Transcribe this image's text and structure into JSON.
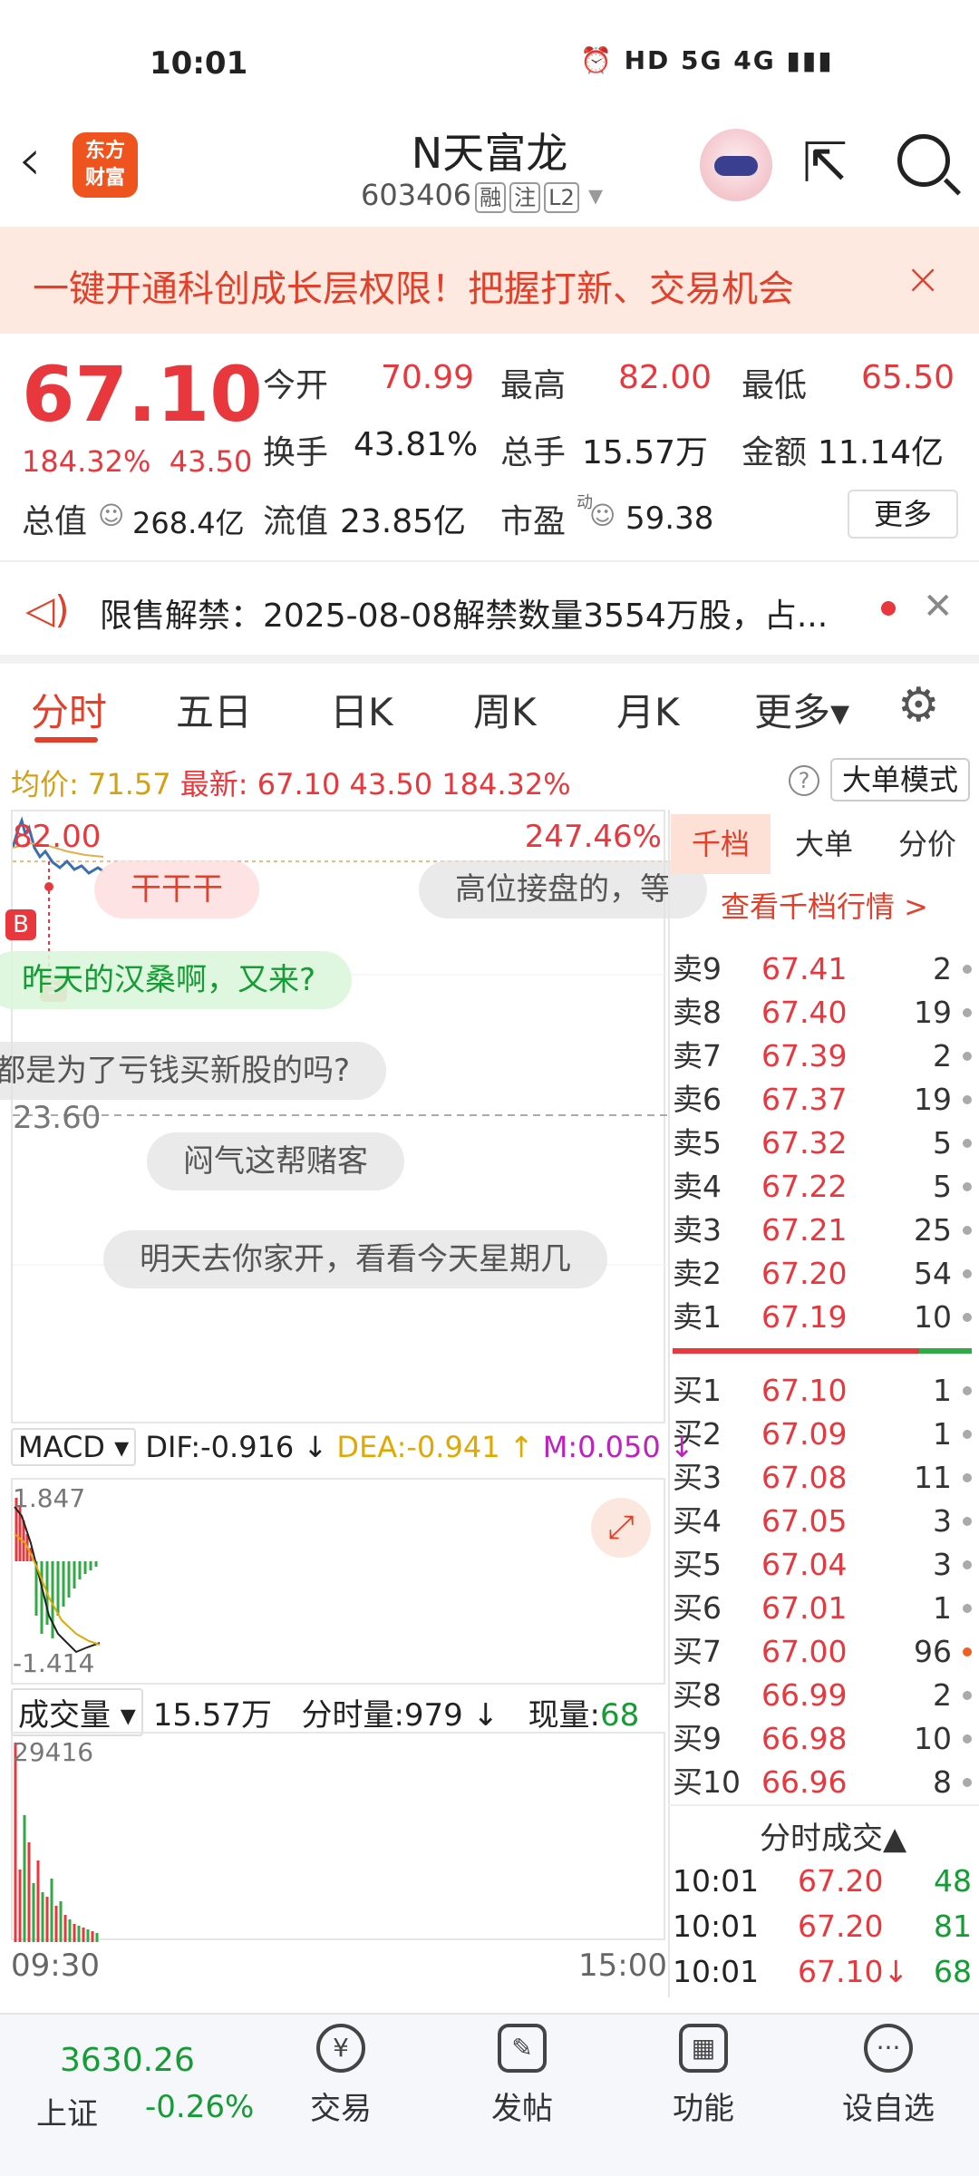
{
  "status": {
    "time": "10:01",
    "icons": "⏰ HD 5G 4G ▮▮▮"
  },
  "header": {
    "logo": "东方\n财富",
    "name": "N天富龙",
    "code": "603406",
    "badges": [
      "融",
      "注",
      "L2"
    ]
  },
  "promo": {
    "text": "一键开通科创成长层权限！把握打新、交易机会",
    "close": "×"
  },
  "quote": {
    "price": "67.10",
    "change_pct": "184.32%",
    "change": "43.50",
    "open_label": "今开",
    "open": "70.99",
    "high_label": "最高",
    "high": "82.00",
    "low_label": "最低",
    "low": "65.50",
    "turnover_label": "换手",
    "turnover": "43.81%",
    "volume_label": "总手",
    "volume": "15.57万",
    "amount_label": "金额",
    "amount": "11.14亿",
    "mcap_label": "总值",
    "mcap": "268.4亿",
    "float_label": "流值",
    "float": "23.85亿",
    "pe_label": "市盈",
    "pe_sup": "动",
    "pe": "59.38",
    "more": "更多"
  },
  "notice": {
    "text": "限售解禁：2025-08-08解禁数量3554万股，占..."
  },
  "tabs": [
    "分时",
    "五日",
    "日K",
    "周K",
    "月K",
    "更多▾"
  ],
  "info": {
    "avg_label": "均价:",
    "avg": "71.57",
    "latest_label": "最新:",
    "latest": "67.10",
    "chg": "43.50",
    "pct": "184.32%",
    "help": "?",
    "bigmode": "大单模式"
  },
  "chart": {
    "top_price": "82.00",
    "top_pct": "247.46%",
    "mid_price": "23.60",
    "danmu": [
      "干干干",
      "高位接盘的，等",
      "昨天的汉桑啊，又来?",
      "都是为了亏钱买新股的吗?",
      "闷气这帮赌客",
      "明天去你家开，看看今天星期几"
    ],
    "marker_b": "B",
    "marker_s": "S"
  },
  "orderbook": {
    "tabs": [
      "千档",
      "大单",
      "分价"
    ],
    "link": "查看千档行情 >",
    "asks": [
      {
        "label": "卖9",
        "price": "67.41",
        "vol": "2"
      },
      {
        "label": "卖8",
        "price": "67.40",
        "vol": "19"
      },
      {
        "label": "卖7",
        "price": "67.39",
        "vol": "2"
      },
      {
        "label": "卖6",
        "price": "67.37",
        "vol": "19"
      },
      {
        "label": "卖5",
        "price": "67.32",
        "vol": "5"
      },
      {
        "label": "卖4",
        "price": "67.22",
        "vol": "5"
      },
      {
        "label": "卖3",
        "price": "67.21",
        "vol": "25"
      },
      {
        "label": "卖2",
        "price": "67.20",
        "vol": "54"
      },
      {
        "label": "卖1",
        "price": "67.19",
        "vol": "10"
      }
    ],
    "bids": [
      {
        "label": "买1",
        "price": "67.10",
        "vol": "1"
      },
      {
        "label": "买2",
        "price": "67.09",
        "vol": "1"
      },
      {
        "label": "买3",
        "price": "67.08",
        "vol": "11"
      },
      {
        "label": "买4",
        "price": "67.05",
        "vol": "3"
      },
      {
        "label": "买5",
        "price": "67.04",
        "vol": "3"
      },
      {
        "label": "买6",
        "price": "67.01",
        "vol": "1"
      },
      {
        "label": "买7",
        "price": "67.00",
        "vol": "96"
      },
      {
        "label": "买8",
        "price": "66.99",
        "vol": "2"
      },
      {
        "label": "买9",
        "price": "66.98",
        "vol": "10"
      },
      {
        "label": "买10",
        "price": "66.96",
        "vol": "8"
      }
    ],
    "trades_title": "分时成交▲",
    "trades": [
      {
        "time": "10:01",
        "price": "67.20",
        "vol": "48"
      },
      {
        "time": "10:01",
        "price": "67.20",
        "vol": "81"
      },
      {
        "time": "10:01",
        "price": "67.10↓",
        "vol": "68"
      }
    ]
  },
  "macd": {
    "label": "MACD ▾",
    "dif": "DIF:-0.916 ↓",
    "dea": "DEA:-0.941 ↑",
    "m": "M:0.050 ↓",
    "top": "1.847",
    "bottom": "-1.414"
  },
  "volume": {
    "label": "成交量 ▾",
    "total": "15.57万",
    "per": "分时量:979 ↓",
    "now_label": "现量:",
    "now": "68",
    "top": "29416"
  },
  "time_axis": {
    "start": "09:30",
    "end": "15:00"
  },
  "bottom_nav": {
    "index_value": "3630.26",
    "index_name": "上证",
    "index_change": "-0.26%",
    "items": [
      {
        "label": "交易",
        "icon": "¥"
      },
      {
        "label": "发帖",
        "icon": "✎"
      },
      {
        "label": "功能",
        "icon": "▦"
      },
      {
        "label": "设自选",
        "icon": "···"
      }
    ]
  }
}
